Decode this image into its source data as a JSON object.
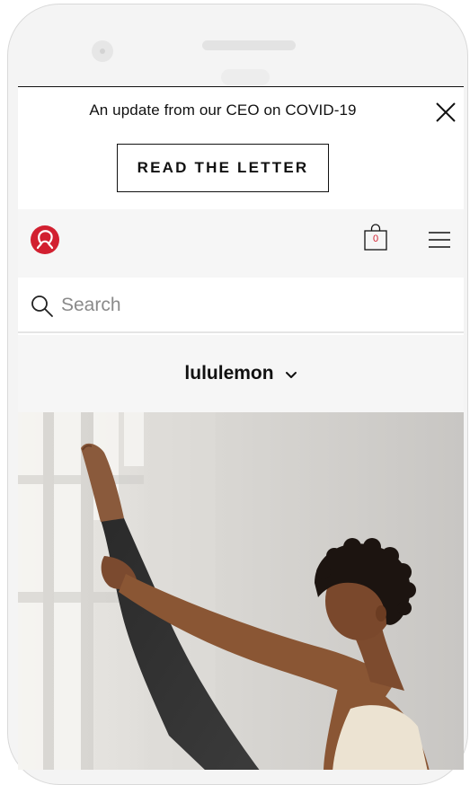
{
  "banner": {
    "message": "An update from our CEO on COVID-19",
    "cta_label": "READ THE LETTER"
  },
  "header": {
    "bag_count": "0"
  },
  "search": {
    "placeholder": "Search"
  },
  "brand_selector": {
    "label": "lululemon"
  },
  "colors": {
    "brand_red": "#d22030",
    "text": "#111111",
    "nav_bg": "#f6f6f6"
  },
  "icons": [
    "close-icon",
    "logo-icon",
    "shopping-bag-icon",
    "hamburger-menu-icon",
    "search-icon",
    "chevron-down-icon"
  ]
}
